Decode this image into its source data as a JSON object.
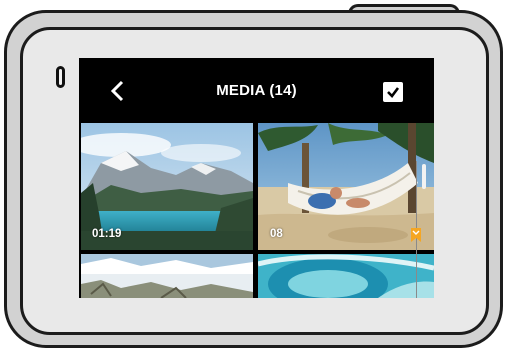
{
  "header": {
    "title": "MEDIA (14)"
  },
  "icons": {
    "back": "chevron-left-icon",
    "select": "checkbox-checked-icon",
    "hilight": "hilight-tag-icon"
  },
  "colors": {
    "accent": "#f5a623",
    "screen_background": "#000000",
    "camera_body": "#d2d2d2"
  },
  "media": {
    "items": [
      {
        "type": "video",
        "label": "01:19"
      },
      {
        "type": "photo",
        "label": "08"
      },
      {
        "type": "photo",
        "label": ""
      },
      {
        "type": "photo",
        "label": ""
      }
    ]
  }
}
